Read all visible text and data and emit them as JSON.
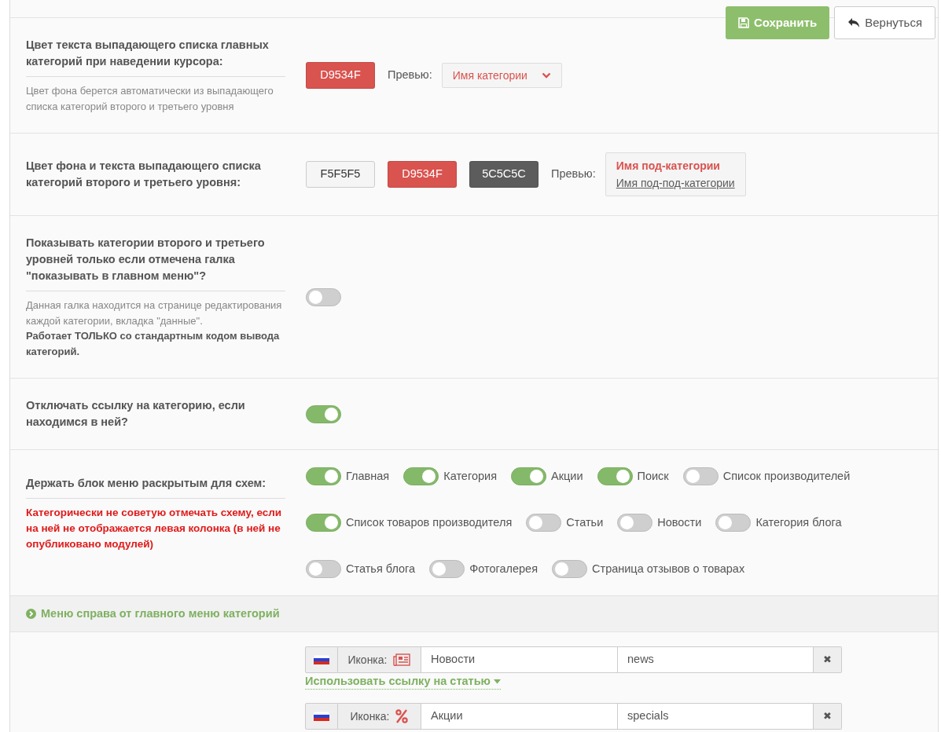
{
  "toolbar": {
    "buttons": [
      {
        "kind": "save",
        "label": "Сохранить"
      },
      {
        "kind": "back",
        "label": "Вернуться"
      }
    ]
  },
  "settings": [
    {
      "kind": "colors",
      "label": "Цвет текста выпадающего списка главных категорий при наведении курсора:",
      "hint": "Цвет фона берется автоматически из выпадающего списка категорий второго и третьего уровня",
      "colors": [
        {
          "value": "D9534F",
          "color": "#d9534f"
        }
      ],
      "preview_label": "Превью:",
      "preview": {
        "kind": "dropdown",
        "items": [
          "Имя категории"
        ]
      }
    },
    {
      "kind": "colors",
      "label": "Цвет фона и текста выпадающего списка категорий второго и третьего уровня:",
      "colors": [
        {
          "value": "F5F5F5",
          "color": "#f5f5f5"
        },
        {
          "value": "D9534F",
          "color": "#d9534f"
        },
        {
          "value": "5C5C5C",
          "color": "#5c5c5c"
        }
      ],
      "preview_label": "Превью:",
      "preview": {
        "kind": "submenu",
        "items": [
          "Имя под-категории",
          "Имя под-под-категории"
        ]
      }
    },
    {
      "kind": "toggle",
      "label": "Показывать категории второго и третьего уровней только если отмечена галка \"показывать в главном меню\"?",
      "hint": "Данная галка находится на странице редактирования каждой категории, вкладка \"данные\".\n**Работает ТОЛЬКО со стандартным кодом вывода категорий.**",
      "on": false
    },
    {
      "kind": "toggle",
      "label": "Отключать ссылку на категорию, если находимся в ней?",
      "on": true
    },
    {
      "kind": "toggle_group",
      "label": "Держать блок меню раскрытым для схем:",
      "warning": "Категорически не советую отмечать схему, если на ней не отображается левая колонка (в ней не опубликовано модулей)",
      "options": [
        {
          "label": "Главная",
          "on": true
        },
        {
          "label": "Категория",
          "on": true
        },
        {
          "label": "Акции",
          "on": true
        },
        {
          "label": "Поиск",
          "on": true
        },
        {
          "label": "Список производителей",
          "on": false
        },
        {
          "label": "Список товаров производителя",
          "on": true
        },
        {
          "label": "Статьи",
          "on": false
        },
        {
          "label": "Новости",
          "on": false
        },
        {
          "label": "Категория блога",
          "on": false
        },
        {
          "label": "Статья блога",
          "on": false
        },
        {
          "label": "Фотогалерея",
          "on": false
        },
        {
          "label": "Страница отзывов о товарах",
          "on": false
        }
      ]
    }
  ],
  "section": {
    "title": "Меню справа от главного меню категорий"
  },
  "menu_items": [
    {
      "icon_label": "Иконка:",
      "kind": "newspaper",
      "title": "Новости",
      "link": "news",
      "remove": "✖",
      "link_toggle": "Использовать ссылку на статью"
    },
    {
      "icon_label": "Иконка:",
      "kind": "percent",
      "title": "Акции",
      "link": "specials",
      "remove": "✖"
    }
  ]
}
